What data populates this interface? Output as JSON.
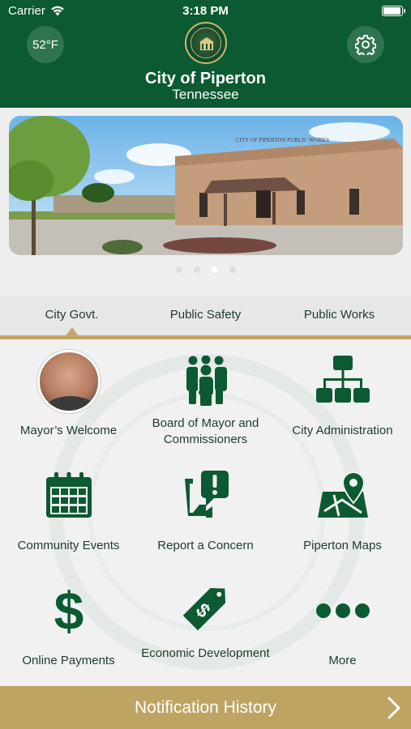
{
  "status_bar": {
    "carrier": "Carrier",
    "time": "3:18 PM"
  },
  "header": {
    "temperature": "52°F",
    "title": "City of Piperton",
    "subtitle": "Tennessee"
  },
  "carousel": {
    "building_sign": "CITY OF PIPERTON PUBLIC WORKS",
    "page_count": 4,
    "active_page": 3
  },
  "tabs": [
    {
      "label": "City Govt.",
      "selected": true
    },
    {
      "label": "Public Safety",
      "selected": false
    },
    {
      "label": "Public Works",
      "selected": false
    }
  ],
  "grid": [
    {
      "label": "Mayor’s Welcome",
      "icon": "mayor-photo"
    },
    {
      "label": "Board of Mayor and Commissioners",
      "icon": "people-group-icon"
    },
    {
      "label": "City Administration",
      "icon": "org-chart-icon"
    },
    {
      "label": "Community Events",
      "icon": "calendar-icon"
    },
    {
      "label": "Report a Concern",
      "icon": "report-concern-icon"
    },
    {
      "label": "Piperton Maps",
      "icon": "map-pin-icon"
    },
    {
      "label": "Online Payments",
      "icon": "dollar-icon"
    },
    {
      "label": "Economic Development",
      "icon": "price-tag-dollar-icon"
    },
    {
      "label": "More",
      "icon": "more-dots-icon"
    }
  ],
  "notification_bar": {
    "label": "Notification History"
  },
  "colors": {
    "brand_green": "#0c5a31",
    "gold": "#bea463",
    "icon_green": "#0c5a31"
  }
}
